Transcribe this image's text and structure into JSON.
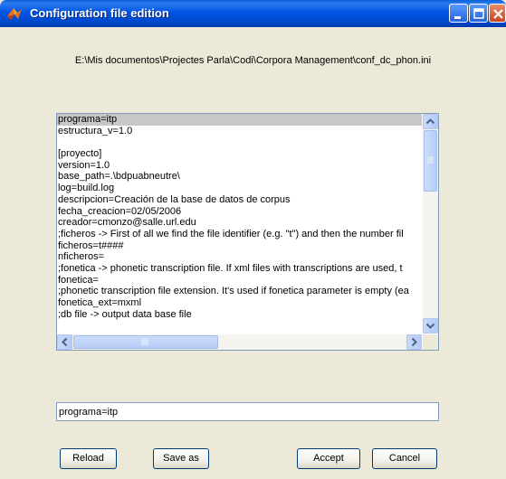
{
  "window": {
    "title": "Configuration file edition"
  },
  "filepath": "E:\\Mis documentos\\Projectes Parla\\Codi\\Corpora Management\\conf_dc_phon.ini",
  "list": {
    "selected_index": 0,
    "items": [
      "programa=itp",
      "estructura_v=1.0",
      "",
      "[proyecto]",
      "version=1.0",
      "base_path=.\\bdpuabneutre\\",
      "log=build.log",
      "descripcion=Creación de la base de datos de corpus",
      "fecha_creacion=02/05/2006",
      "creador=cmonzo@salle.url.edu",
      ";ficheros -> First of all we find the file identifier (e.g. \"t\") and then the number fil",
      "ficheros=t####",
      "nficheros=",
      ";fonetica -> phonetic transcription file. If xml files with transcriptions are used, t",
      "fonetica=",
      ";phonetic transcription file extension. It's used if fonetica parameter is empty (ea",
      "fonetica_ext=mxml",
      ";db  file -> output data base file"
    ]
  },
  "edit": {
    "value": "programa=itp"
  },
  "buttons": {
    "reload": "Reload",
    "save_as": "Save as",
    "accept": "Accept",
    "cancel": "Cancel"
  },
  "icons": {
    "app": "matlab-icon",
    "minimize": "minimize-icon",
    "maximize": "maximize-icon",
    "close": "close-icon"
  },
  "colors": {
    "titlebar": "#0054e3",
    "window_bg": "#ece9d8",
    "selection": "#c7c7c7",
    "border": "#7f9db9"
  }
}
